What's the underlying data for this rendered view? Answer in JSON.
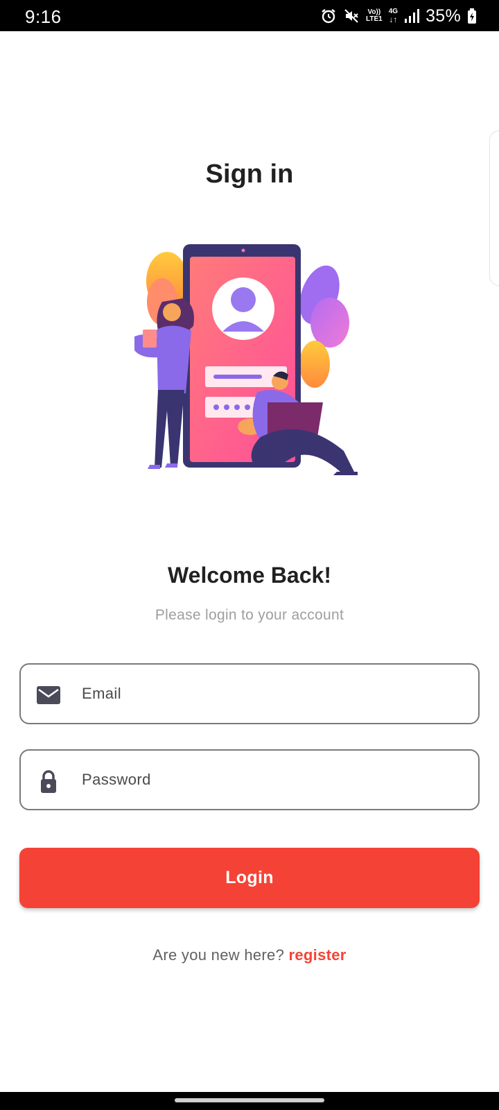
{
  "status_bar": {
    "time": "9:16",
    "volte_top": "Vo))",
    "volte_bottom": "LTE1",
    "network_type": "4G",
    "battery": "35%",
    "icons": [
      "alarm-icon",
      "mute-icon",
      "volte-icon",
      "data-arrows-icon",
      "signal-icon",
      "battery-charging-icon"
    ]
  },
  "page": {
    "title": "Sign in",
    "welcome": "Welcome Back!",
    "subtitle": "Please login to your account"
  },
  "form": {
    "email": {
      "placeholder": "Email",
      "value": "",
      "icon": "email-icon"
    },
    "password": {
      "placeholder": "Password",
      "value": "",
      "icon": "lock-icon"
    },
    "login_label": "Login"
  },
  "register": {
    "prompt": "Are you new here? ",
    "link_label": "register"
  },
  "colors": {
    "accent": "#f44336",
    "title_text": "#212121",
    "subtitle_text": "#9e9e9e",
    "field_border": "#7a7a7a"
  }
}
